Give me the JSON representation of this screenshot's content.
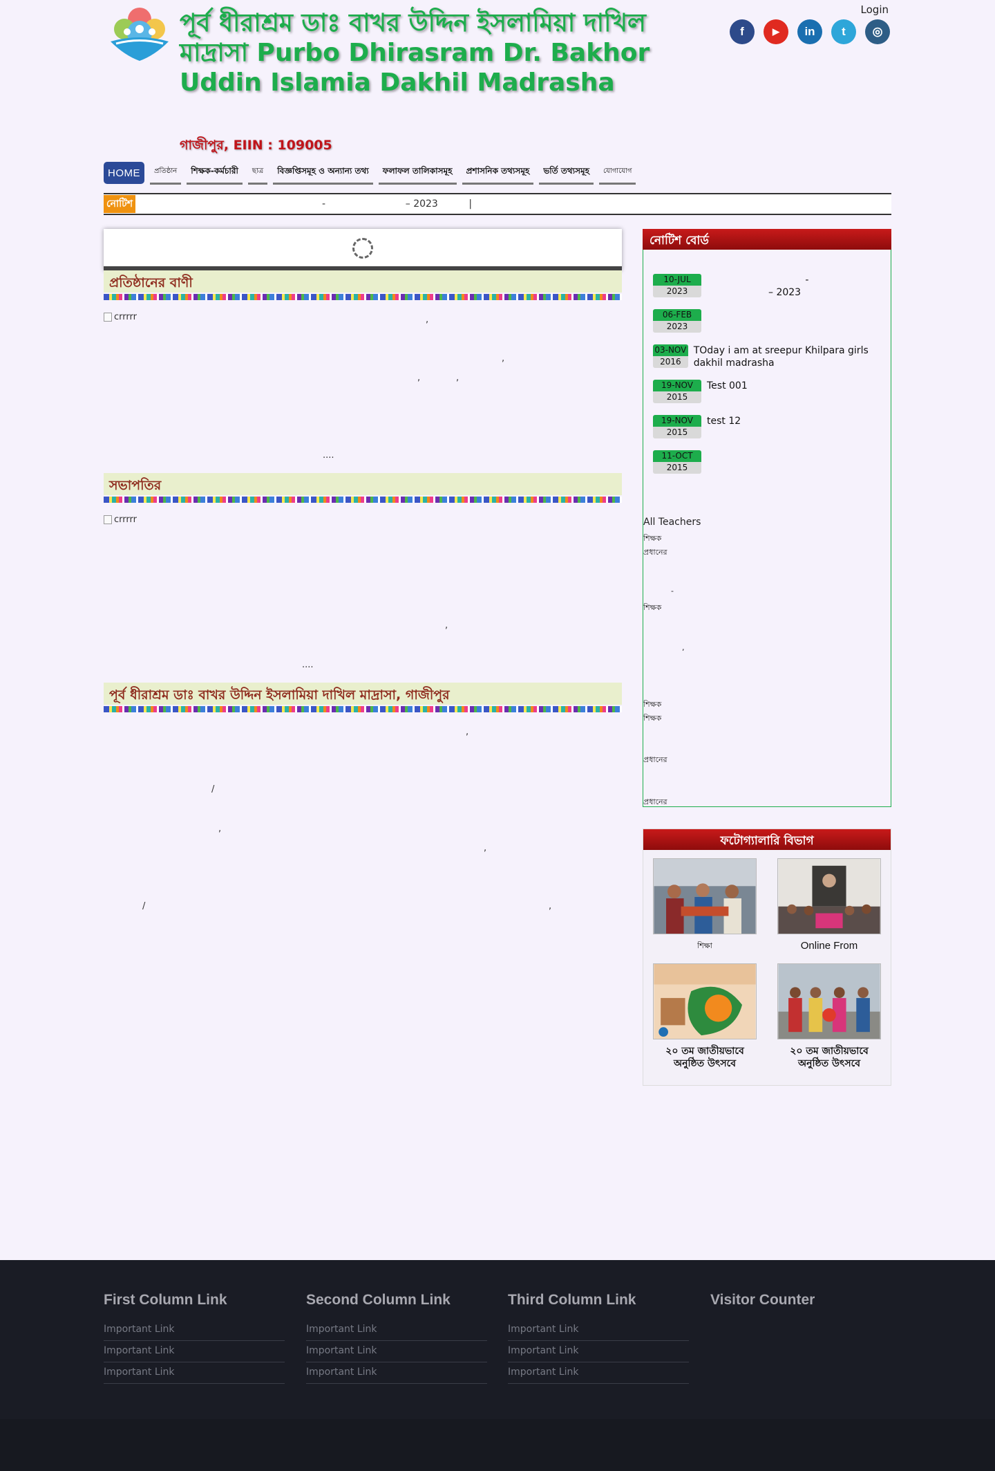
{
  "header": {
    "title": "পূর্ব ধীরাশ্রম ডাঃ বাখর উদ্দিন ইসলামিয়া দাখিল মাদ্রাসা Purbo Dhirasram Dr. Bakhor Uddin Islamia Dakhil Madrasha",
    "eiin": "গাজীপুর, EIIN : 109005",
    "login": "Login",
    "social": [
      {
        "name": "facebook",
        "glyph": "f",
        "color": "#2d4a8a"
      },
      {
        "name": "youtube",
        "glyph": "▶",
        "color": "#e02a20"
      },
      {
        "name": "linkedin",
        "glyph": "in",
        "color": "#1a6fb0"
      },
      {
        "name": "twitter",
        "glyph": "t",
        "color": "#2ea6d9"
      },
      {
        "name": "instagram",
        "glyph": "◎",
        "color": "#2d5d86"
      }
    ]
  },
  "nav": {
    "items": [
      "HOME",
      "প্রতিষ্ঠান",
      "শিক্ষক-কর্মচারী",
      "ছাত্র",
      "বিজ্ঞপ্তিসমূহ ও অন্যান্য তথ্য",
      "ফলাফল তালিকাসমূহ",
      "প্রশাসনিক তথ্যসমূহ",
      "ভর্তি তথ্যসমূহ",
      "যোগাযোগ"
    ]
  },
  "ticker": {
    "label": "নোটিশ",
    "text": "-                          – 2023          |"
  },
  "main": {
    "section1": "প্রতিষ্ঠানের বাণী",
    "section2": "সভাপতির",
    "section3": "পূর্ব ধীরাশ্রম ডাঃ বাখর উদ্দিন ইসলামিয়া দাখিল মাদ্রাসা, গাজীপুর",
    "img_alt": "crrrrr",
    "more": "....",
    "comma": ",",
    "slash": "/"
  },
  "sidebar": {
    "notice_title": "নোটিশ বোর্ড",
    "notices": [
      {
        "d1": "10-JUL",
        "d2": "2023",
        "title": "                                -\n                    – 2023"
      },
      {
        "d1": "06-FEB",
        "d2": "2023",
        "title": ""
      },
      {
        "d1": "03-NOV",
        "d2": "2016",
        "title": "TOday i am at sreepur Khilpara girls dakhil madrasha"
      },
      {
        "d1": "19-NOV",
        "d2": "2015",
        "title": "Test 001"
      },
      {
        "d1": "19-NOV",
        "d2": "2015",
        "title": "test 12"
      },
      {
        "d1": "11-OCT",
        "d2": "2015",
        "title": ""
      }
    ],
    "all_teachers": "All Teachers",
    "teacher_lines": [
      "শিক্ষক",
      "প্রধানের",
      "-",
      "শিক্ষক",
      ",",
      "শিক্ষক",
      "শিক্ষক",
      "প্রধানের",
      "প্রধানের"
    ],
    "gallery_title": "ফটোগ্যালারি বিভাগ",
    "gallery": [
      {
        "caption": "শিক্ষা"
      },
      {
        "caption": "Online From"
      },
      {
        "caption": "২০ তম জাতীয়ভাবে অনুষ্ঠিত উৎসবে"
      },
      {
        "caption": "২০ তম জাতীয়ভাবে অনুষ্ঠিত উৎসবে"
      }
    ]
  },
  "footer": {
    "columns": [
      {
        "title": "First Column Link",
        "links": [
          "Important Link",
          "Important Link",
          "Important Link"
        ]
      },
      {
        "title": "Second Column Link",
        "links": [
          "Important Link",
          "Important Link",
          "Important Link"
        ]
      },
      {
        "title": "Third Column Link",
        "links": [
          "Important Link",
          "Important Link",
          "Important Link"
        ]
      },
      {
        "title": "Visitor Counter",
        "links": []
      }
    ]
  }
}
